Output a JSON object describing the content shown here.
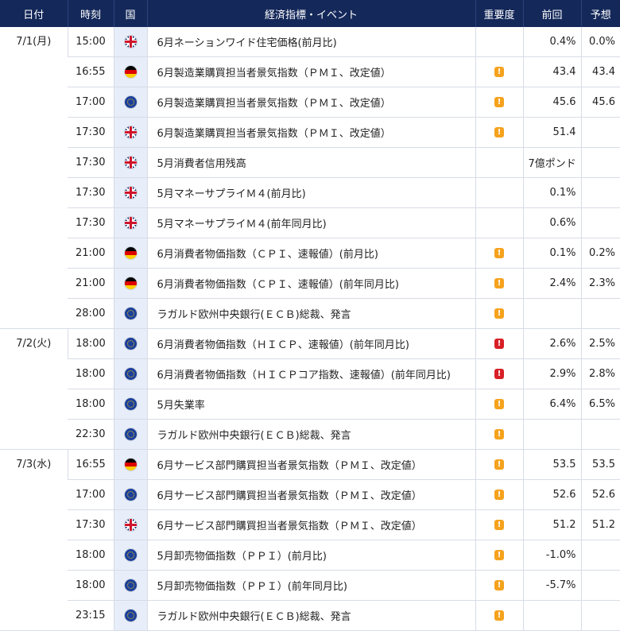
{
  "headers": {
    "date": "日付",
    "time": "時刻",
    "country": "国",
    "event": "経済指標・イベント",
    "importance": "重要度",
    "previous": "前回",
    "forecast": "予想"
  },
  "icons": {
    "importance_medium": "exclamation-orange-icon",
    "importance_high": "exclamation-red-icon"
  },
  "colors": {
    "header_bg": "#14285a",
    "country_col_bg": "#e7eef9",
    "importance_medium": "#f5a21d",
    "importance_high": "#d81f26"
  },
  "days": [
    {
      "date": "7/1(月)",
      "rows": [
        {
          "time": "15:00",
          "country": "gb",
          "event": "6月ネーションワイド住宅価格(前月比)",
          "importance": "",
          "previous": "0.4%",
          "forecast": "0.0%"
        },
        {
          "time": "16:55",
          "country": "de",
          "event": "6月製造業購買担当者景気指数（ＰＭＩ、改定値）",
          "importance": "medium",
          "previous": "43.4",
          "forecast": "43.4"
        },
        {
          "time": "17:00",
          "country": "eu",
          "event": "6月製造業購買担当者景気指数（ＰＭＩ、改定値）",
          "importance": "medium",
          "previous": "45.6",
          "forecast": "45.6"
        },
        {
          "time": "17:30",
          "country": "gb",
          "event": "6月製造業購買担当者景気指数（ＰＭＩ、改定値）",
          "importance": "medium",
          "previous": "51.4",
          "forecast": ""
        },
        {
          "time": "17:30",
          "country": "gb",
          "event": "5月消費者信用残高",
          "importance": "",
          "previous": "7億ポンド",
          "forecast": ""
        },
        {
          "time": "17:30",
          "country": "gb",
          "event": "5月マネーサプライＭ４(前月比)",
          "importance": "",
          "previous": "0.1%",
          "forecast": ""
        },
        {
          "time": "17:30",
          "country": "gb",
          "event": "5月マネーサプライＭ４(前年同月比)",
          "importance": "",
          "previous": "0.6%",
          "forecast": ""
        },
        {
          "time": "21:00",
          "country": "de",
          "event": "6月消費者物価指数（ＣＰＩ、速報値）(前月比)",
          "importance": "medium",
          "previous": "0.1%",
          "forecast": "0.2%"
        },
        {
          "time": "21:00",
          "country": "de",
          "event": "6月消費者物価指数（ＣＰＩ、速報値）(前年同月比)",
          "importance": "medium",
          "previous": "2.4%",
          "forecast": "2.3%"
        },
        {
          "time": "28:00",
          "country": "eu",
          "event": "ラガルド欧州中央銀行(ＥＣＢ)総裁、発言",
          "importance": "medium",
          "previous": "",
          "forecast": ""
        }
      ]
    },
    {
      "date": "7/2(火)",
      "rows": [
        {
          "time": "18:00",
          "country": "eu",
          "event": "6月消費者物価指数（ＨＩＣＰ、速報値）(前年同月比)",
          "importance": "high",
          "previous": "2.6%",
          "forecast": "2.5%"
        },
        {
          "time": "18:00",
          "country": "eu",
          "event": "6月消費者物価指数（ＨＩＣＰコア指数、速報値）(前年同月比)",
          "importance": "high",
          "previous": "2.9%",
          "forecast": "2.8%"
        },
        {
          "time": "18:00",
          "country": "eu",
          "event": "5月失業率",
          "importance": "medium",
          "previous": "6.4%",
          "forecast": "6.5%"
        },
        {
          "time": "22:30",
          "country": "eu",
          "event": "ラガルド欧州中央銀行(ＥＣＢ)総裁、発言",
          "importance": "medium",
          "previous": "",
          "forecast": ""
        }
      ]
    },
    {
      "date": "7/3(水)",
      "rows": [
        {
          "time": "16:55",
          "country": "de",
          "event": "6月サービス部門購買担当者景気指数（ＰＭＩ、改定値）",
          "importance": "medium",
          "previous": "53.5",
          "forecast": "53.5"
        },
        {
          "time": "17:00",
          "country": "eu",
          "event": "6月サービス部門購買担当者景気指数（ＰＭＩ、改定値）",
          "importance": "medium",
          "previous": "52.6",
          "forecast": "52.6"
        },
        {
          "time": "17:30",
          "country": "gb",
          "event": "6月サービス部門購買担当者景気指数（ＰＭＩ、改定値）",
          "importance": "medium",
          "previous": "51.2",
          "forecast": "51.2"
        },
        {
          "time": "18:00",
          "country": "eu",
          "event": "5月卸売物価指数（ＰＰＩ）(前月比)",
          "importance": "medium",
          "previous": "-1.0%",
          "forecast": ""
        },
        {
          "time": "18:00",
          "country": "eu",
          "event": "5月卸売物価指数（ＰＰＩ）(前年同月比)",
          "importance": "medium",
          "previous": "-5.7%",
          "forecast": ""
        },
        {
          "time": "23:15",
          "country": "eu",
          "event": "ラガルド欧州中央銀行(ＥＣＢ)総裁、発言",
          "importance": "medium",
          "previous": "",
          "forecast": ""
        }
      ]
    }
  ]
}
